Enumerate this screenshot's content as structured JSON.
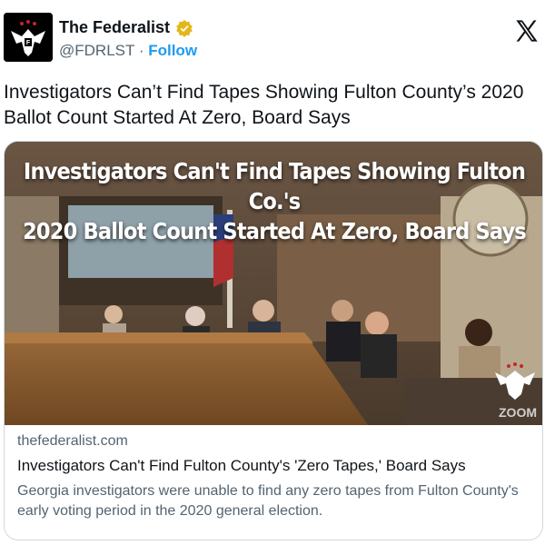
{
  "account": {
    "name": "The Federalist",
    "handle": "@FDRLST",
    "separator": "·",
    "follow_label": "Follow",
    "verified": true
  },
  "platform_icon": "x-logo-icon",
  "tweet": {
    "text": "Investigators Can’t Find Tapes Showing Fulton County’s 2020 Ballot Count Started At Zero, Board Says"
  },
  "card": {
    "image_headline_line1": "Investigators Can't Find Tapes Showing Fulton Co.'s",
    "image_headline_line2": "2020 Ballot Count Started At Zero, Board Says",
    "image_watermark": "ZOOM",
    "domain": "thefederalist.com",
    "title": "Investigators Can't Find Fulton County's 'Zero Tapes,' Board Says",
    "description": "Georgia investigators were unable to find any zero tapes from Fulton County's early voting period in the 2020 general election."
  },
  "colors": {
    "link": "#1d9bf0",
    "verified_badge": "#e2b719",
    "secondary_text": "#536471"
  }
}
